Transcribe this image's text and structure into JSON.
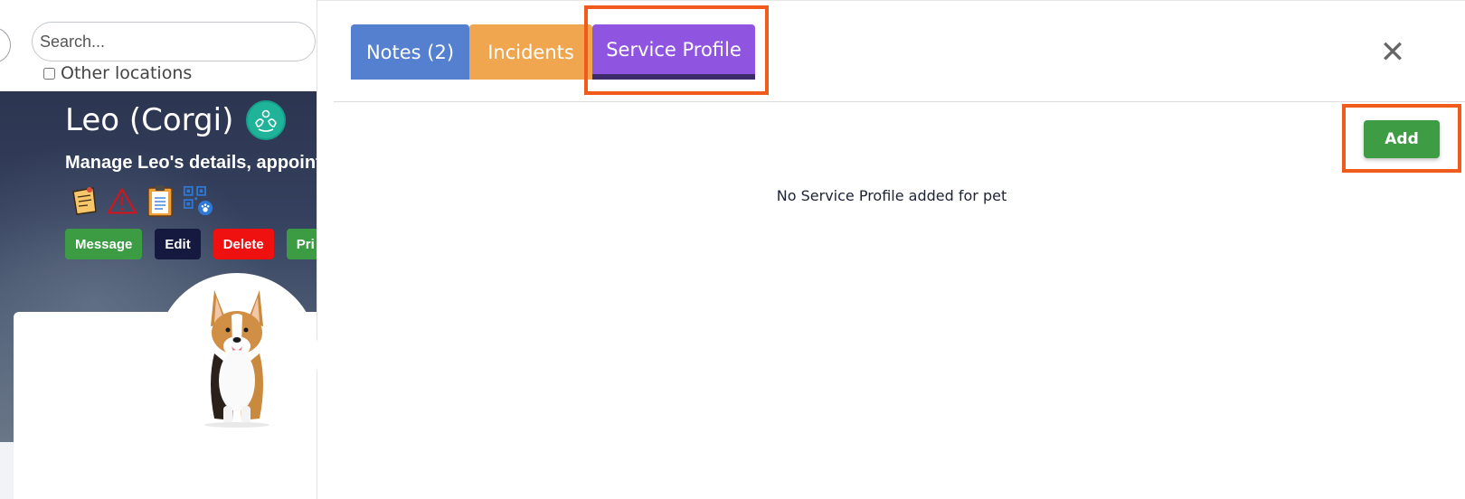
{
  "background_page": {
    "search": {
      "placeholder": "Search..."
    },
    "other_locations_label": "Other locations",
    "pet": {
      "title": "Leo (Corgi)",
      "subtitle": "Manage Leo's details, appoint",
      "badge_icon": "dog-grooming-icon",
      "status_icons": [
        "sticky-note-icon",
        "warning-triangle-icon",
        "clipboard-icon",
        "qr-paw-icon"
      ]
    },
    "actions": {
      "message": "Message",
      "edit": "Edit",
      "delete": "Delete",
      "pricing": "Pri"
    },
    "colors": {
      "message": "#3c9c44",
      "edit": "#15193f",
      "delete": "#ef1010",
      "badge": "#1fb39a"
    }
  },
  "modal": {
    "tabs": [
      {
        "label": "Notes (2)",
        "color": "#5580cf",
        "active": false
      },
      {
        "label": "Incidents",
        "color": "#f0a64e",
        "active": false
      },
      {
        "label": "Service Profile",
        "color": "#8f55e0",
        "active": true
      }
    ],
    "close_icon": "close-icon",
    "add_label": "Add",
    "empty_message": "No Service Profile added for pet",
    "highlight_color": "#f05a1a"
  }
}
